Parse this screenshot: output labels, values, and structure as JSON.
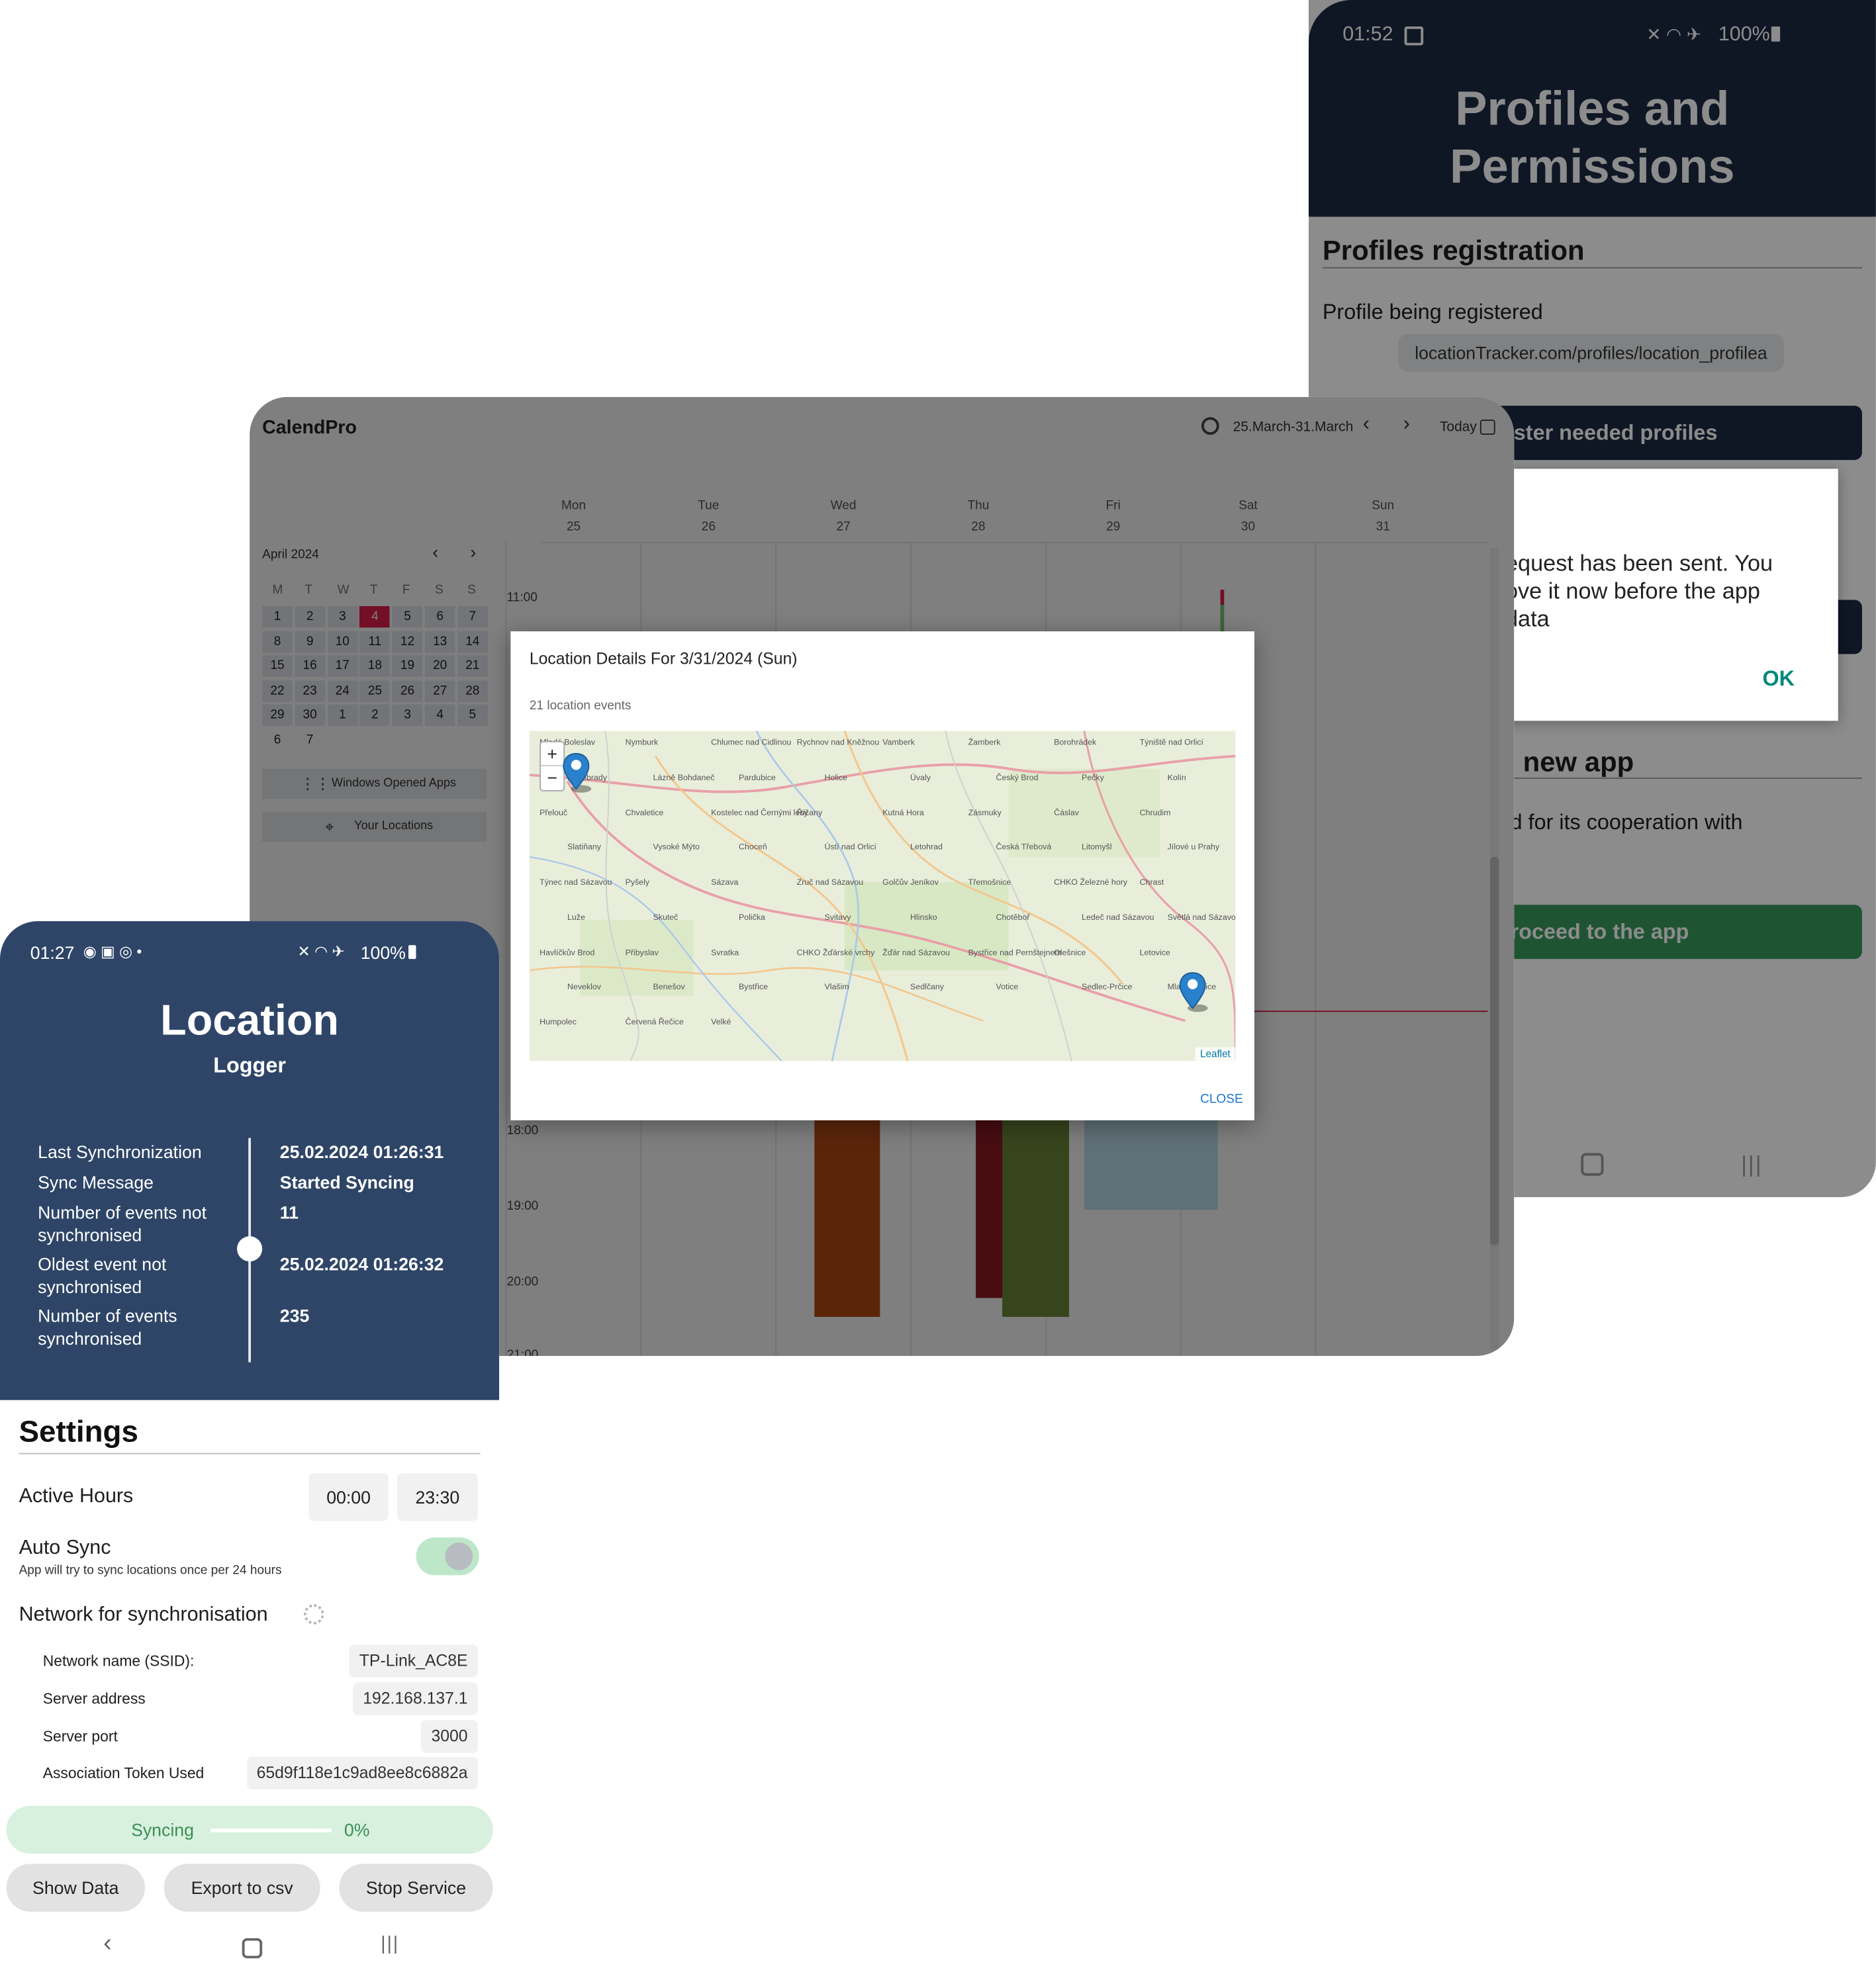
{
  "profiles_phone": {
    "status_time": "01:52",
    "status_right": "100%",
    "title_line1": "Profiles and",
    "title_line2": "Permissions",
    "section_registration": "Profiles registration",
    "profile_label": "Profile being registered",
    "profile_value": "locationTracker.com/profiles/location_profilea",
    "register_button": "ister needed profiles",
    "dialog_line1": "equest has been sent. You",
    "dialog_line2": "ove it now before the app",
    "dialog_line3": "data",
    "dialog_ok": "OK",
    "section_new_app": "new app",
    "new_app_text": "d for its cooperation with",
    "proceed_button": "roceed to the app"
  },
  "calendar": {
    "app_title": "CalendPro",
    "date_range": "25.March-31.March",
    "today_label": "Today",
    "mini_month": "April 2024",
    "weekday_initials": [
      "M",
      "T",
      "W",
      "T",
      "F",
      "S",
      "S"
    ],
    "mini_days": [
      [
        "1",
        "2",
        "3",
        "4",
        "5",
        "6",
        "7"
      ],
      [
        "8",
        "9",
        "10",
        "11",
        "12",
        "13",
        "14"
      ],
      [
        "15",
        "16",
        "17",
        "18",
        "19",
        "20",
        "21"
      ],
      [
        "22",
        "23",
        "24",
        "25",
        "26",
        "27",
        "28"
      ],
      [
        "29",
        "30",
        "1",
        "2",
        "3",
        "4",
        "5"
      ],
      [
        "6",
        "7"
      ]
    ],
    "selected_day": "4",
    "side_buttons": [
      "Windows Opened Apps",
      "Your Locations"
    ],
    "days": [
      {
        "name": "Mon",
        "num": "25"
      },
      {
        "name": "Tue",
        "num": "26"
      },
      {
        "name": "Wed",
        "num": "27"
      },
      {
        "name": "Thu",
        "num": "28"
      },
      {
        "name": "Fri",
        "num": "29"
      },
      {
        "name": "Sat",
        "num": "30"
      },
      {
        "name": "Sun",
        "num": "31"
      }
    ],
    "time_labels": [
      "11:00",
      "18:00",
      "19:00",
      "20:00",
      "21:00"
    ],
    "event_colors": {
      "orange": "#b84a14",
      "red": "#8e1a22",
      "green": "#6e8b3a",
      "blue": "#bfe2ee",
      "accent": "#e61e4d"
    }
  },
  "modal": {
    "title": "Location Details For 3/31/2024 (Sun)",
    "count_text": "21 location events",
    "zoom_in": "+",
    "zoom_out": "−",
    "attribution": "Leaflet",
    "close": "CLOSE",
    "map_places": [
      "Mladá Boleslav",
      "Nymburk",
      "Chlumec nad Cidlinou",
      "Rychnov nad Kněžnou",
      "Vamberk",
      "Žamberk",
      "Borohrádek",
      "Týniště nad Orlicí",
      "Poděbrady",
      "Lázně Bohdaneč",
      "Pardubice",
      "Holice",
      "Úvaly",
      "Český Brod",
      "Pečky",
      "Kolín",
      "Přelouč",
      "Chvaletice",
      "Kostelec nad Černými lesy",
      "Říčany",
      "Kutná Hora",
      "Zásmuky",
      "Čáslav",
      "Chrudim",
      "Slatiňany",
      "Vysoké Mýto",
      "Choceň",
      "Ústí nad Orlicí",
      "Letohrad",
      "Česká Třebová",
      "Litomyšl",
      "Jílové u Prahy",
      "Týnec nad Sázavou",
      "Pyšely",
      "Sázava",
      "Zruč nad Sázavou",
      "Golčův Jeníkov",
      "Třemošnice",
      "CHKO Železné hory",
      "Chrast",
      "Luže",
      "Skuteč",
      "Polička",
      "Svitavy",
      "Hlinsko",
      "Chotěboř",
      "Ledeč nad Sázavou",
      "Světlá nad Sázavou",
      "Havlíčkův Brod",
      "Přibyslav",
      "Svratka",
      "CHKO Žďárské vrchy",
      "Žďár nad Sázavou",
      "Bystřice nad Pernštejnem",
      "Olešnice",
      "Letovice",
      "Neveklov",
      "Benešov",
      "Bystřice",
      "Vlašim",
      "Sedlčany",
      "Votice",
      "Sedlec-Prčice",
      "Mladá Vožice",
      "Humpolec",
      "Červená Řečice",
      "Velké"
    ]
  },
  "location_phone": {
    "status_time": "01:27",
    "status_right": "100%",
    "title": "Location",
    "subtitle": "Logger",
    "rows": [
      {
        "label1": "Last Synchronization",
        "label2": "",
        "value": "25.02.2024 01:26:31"
      },
      {
        "label1": "Sync Message",
        "label2": "",
        "value": "Started Syncing"
      },
      {
        "label1": "Number of events not",
        "label2": "synchronised",
        "value": "11"
      },
      {
        "label1": "Oldest event not",
        "label2": "synchronised",
        "value": "25.02.2024 01:26:32"
      },
      {
        "label1": "Number of events",
        "label2": "synchronised",
        "value": "235"
      }
    ],
    "settings_title": "Settings",
    "active_hours_label": "Active Hours",
    "active_from": "00:00",
    "active_to": "23:30",
    "auto_sync_label": "Auto Sync",
    "auto_sync_hint": "App will try to sync locations once per 24 hours",
    "auto_sync_on": true,
    "network_label": "Network for synchronisation",
    "network_rows": [
      {
        "label": "Network name (SSID):",
        "value": "TP-Link_AC8E"
      },
      {
        "label": "Server address",
        "value": "192.168.137.1"
      },
      {
        "label": "Server port",
        "value": "3000"
      },
      {
        "label": "Association Token Used",
        "value": "65d9f118e1c9ad8ee8c6882a"
      }
    ],
    "syncing_label": "Syncing",
    "progress_percent": "0%",
    "progress": 0,
    "buttons": [
      "Show Data",
      "Export to csv",
      "Stop Service"
    ]
  }
}
